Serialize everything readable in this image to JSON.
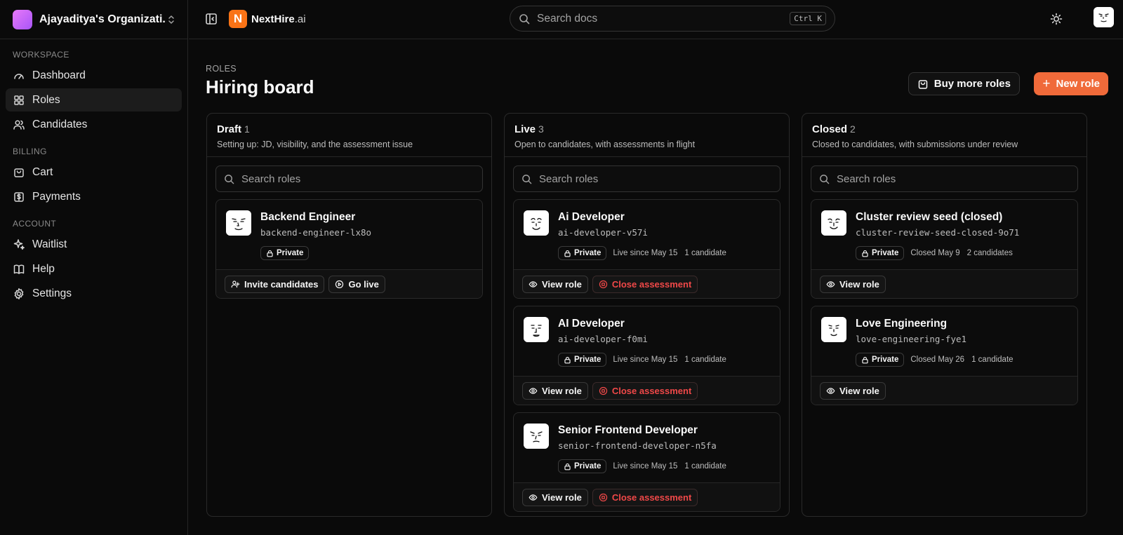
{
  "org": {
    "name": "Ajayaditya's Organizati..."
  },
  "brand": {
    "name": "NextHire",
    "suffix": ".ai",
    "logo_letter": "N",
    "color": "#f97316"
  },
  "search": {
    "placeholder": "Search docs",
    "shortcut": "Ctrl K"
  },
  "sidebar": {
    "sections": [
      {
        "label": "WORKSPACE",
        "items": [
          {
            "label": "Dashboard",
            "icon": "gauge-icon",
            "active": false
          },
          {
            "label": "Roles",
            "icon": "grid-icon",
            "active": true
          },
          {
            "label": "Candidates",
            "icon": "users-icon",
            "active": false
          }
        ]
      },
      {
        "label": "BILLING",
        "items": [
          {
            "label": "Cart",
            "icon": "bag-icon",
            "active": false
          },
          {
            "label": "Payments",
            "icon": "dollar-icon",
            "active": false
          }
        ]
      },
      {
        "label": "ACCOUNT",
        "items": [
          {
            "label": "Waitlist",
            "icon": "sparkle-icon",
            "active": false
          },
          {
            "label": "Help",
            "icon": "book-icon",
            "active": false
          },
          {
            "label": "Settings",
            "icon": "gear-icon",
            "active": false
          }
        ]
      }
    ]
  },
  "page": {
    "eyebrow": "ROLES",
    "title": "Hiring board",
    "buy_label": "Buy more roles",
    "new_label": "New role",
    "accent": "#f06a3a"
  },
  "columns": [
    {
      "title": "Draft",
      "count": "1",
      "desc": "Setting up: JD, visibility, and the assessment issue",
      "search_placeholder": "Search roles",
      "cards": [
        {
          "title": "Backend Engineer",
          "slug": "backend-engineer-lx8o",
          "visibility": "Private",
          "status": "",
          "candidates": "",
          "actions": [
            {
              "label": "Invite candidates",
              "icon": "user-plus-icon",
              "danger": false
            },
            {
              "label": "Go live",
              "icon": "play-circle-icon",
              "danger": false
            }
          ]
        }
      ]
    },
    {
      "title": "Live",
      "count": "3",
      "desc": "Open to candidates, with assessments in flight",
      "search_placeholder": "Search roles",
      "cards": [
        {
          "title": "Ai Developer",
          "slug": "ai-developer-v57i",
          "visibility": "Private",
          "status": "Live since May 15",
          "candidates": "1 candidate",
          "actions": [
            {
              "label": "View role",
              "icon": "eye-icon",
              "danger": false
            },
            {
              "label": "Close assessment",
              "icon": "stop-circle-icon",
              "danger": true
            }
          ]
        },
        {
          "title": "AI Developer",
          "slug": "ai-developer-f0mi",
          "visibility": "Private",
          "status": "Live since May 15",
          "candidates": "1 candidate",
          "actions": [
            {
              "label": "View role",
              "icon": "eye-icon",
              "danger": false
            },
            {
              "label": "Close assessment",
              "icon": "stop-circle-icon",
              "danger": true
            }
          ]
        },
        {
          "title": "Senior Frontend Developer",
          "slug": "senior-frontend-developer-n5fa",
          "visibility": "Private",
          "status": "Live since May 15",
          "candidates": "1 candidate",
          "actions": [
            {
              "label": "View role",
              "icon": "eye-icon",
              "danger": false
            },
            {
              "label": "Close assessment",
              "icon": "stop-circle-icon",
              "danger": true
            }
          ]
        }
      ]
    },
    {
      "title": "Closed",
      "count": "2",
      "desc": "Closed to candidates, with submissions under review",
      "search_placeholder": "Search roles",
      "cards": [
        {
          "title": "Cluster review seed (closed)",
          "slug": "cluster-review-seed-closed-9o71",
          "visibility": "Private",
          "status": "Closed May 9",
          "candidates": "2 candidates",
          "actions": [
            {
              "label": "View role",
              "icon": "eye-icon",
              "danger": false
            }
          ]
        },
        {
          "title": "Love Engineering",
          "slug": "love-engineering-fye1",
          "visibility": "Private",
          "status": "Closed May 26",
          "candidates": "1 candidate",
          "actions": [
            {
              "label": "View role",
              "icon": "eye-icon",
              "danger": false
            }
          ]
        }
      ]
    }
  ]
}
